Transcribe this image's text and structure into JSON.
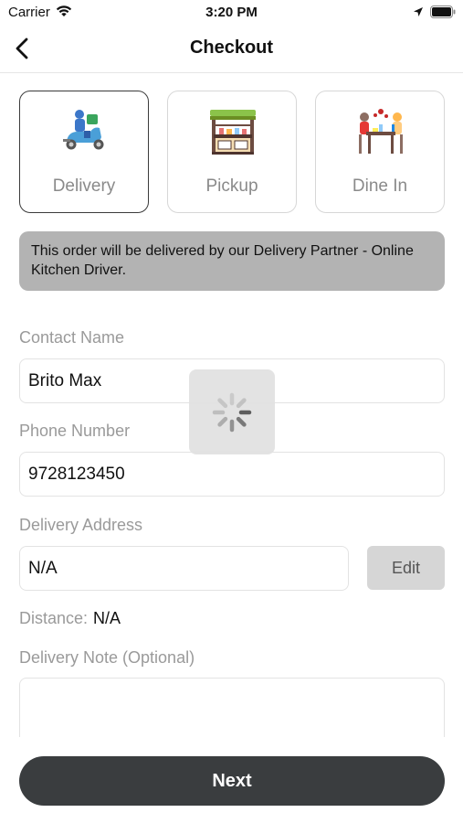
{
  "status_bar": {
    "carrier": "Carrier",
    "time": "3:20 PM"
  },
  "nav": {
    "title": "Checkout",
    "back_icon": "chevron-left-icon"
  },
  "order_types": [
    {
      "label": "Delivery",
      "icon": "delivery-scooter-icon",
      "selected": true
    },
    {
      "label": "Pickup",
      "icon": "pickup-stall-icon",
      "selected": false
    },
    {
      "label": "Dine In",
      "icon": "dine-in-table-icon",
      "selected": false
    }
  ],
  "info_banner": {
    "text": "This order will be delivered by our Delivery Partner - Online Kitchen Driver."
  },
  "form": {
    "contact_name": {
      "label": "Contact Name",
      "value": "Brito Max"
    },
    "phone_number": {
      "label": "Phone Number",
      "value": "9728123450"
    },
    "delivery_address": {
      "label": "Delivery Address",
      "value": "N/A",
      "edit_label": "Edit"
    },
    "distance": {
      "label": "Distance:",
      "value": "N/A"
    },
    "delivery_note": {
      "label": "Delivery Note (Optional)",
      "value": ""
    }
  },
  "next_button": {
    "label": "Next"
  },
  "colors": {
    "primary_button": "#3a3d3f",
    "banner_bg": "#b3b3b3",
    "selected_border": "#3b3b3b",
    "label_gray": "#9a9a9a"
  }
}
